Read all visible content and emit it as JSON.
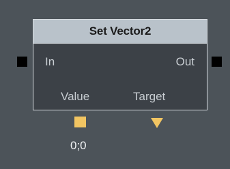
{
  "node": {
    "title": "Set Vector2",
    "inputs": {
      "in_label": "In",
      "value_label": "Value",
      "target_label": "Target"
    },
    "outputs": {
      "out_label": "Out"
    },
    "value_default": "0;0"
  },
  "colors": {
    "canvas_background": "#4c5359",
    "node_body": "#3c4147",
    "node_header": "#b9c2ca",
    "node_border": "#d8dde2",
    "exec_pin": "#000000",
    "data_pin": "#f2c562"
  },
  "icons": {
    "in_pin": "square-pin",
    "out_pin": "square-pin",
    "value_pin": "square-pin",
    "target_pin": "triangle-pin"
  }
}
